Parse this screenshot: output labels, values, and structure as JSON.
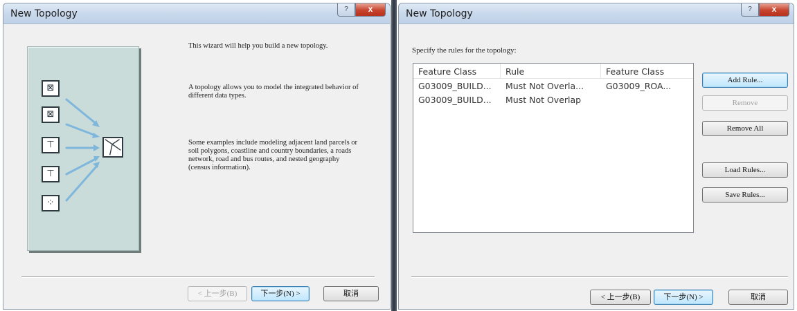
{
  "left_window": {
    "title": "New Topology",
    "close_label": "x",
    "help_label": "?",
    "illustration": {
      "feature_icons": [
        "polygon-layer-icon",
        "polygon-layer-icon",
        "line-layer-icon",
        "line-layer-icon",
        "point-layer-icon"
      ],
      "result_icon": "topology-icon"
    },
    "paragraphs": [
      "This wizard will help you build a new topology.",
      "A topology allows you to model the integrated behavior of different data types.",
      "Some examples include modeling adjacent land parcels or soil polygons, coastline and country boundaries, a roads network, road and bus routes, and nested geography (census information)."
    ],
    "buttons": {
      "back": "< 上一步(B)",
      "next": "下一步(N) >",
      "cancel": "取消"
    }
  },
  "right_window": {
    "title": "New Topology",
    "close_label": "x",
    "help_label": "?",
    "prompt": "Specify the rules for the topology:",
    "columns": [
      "Feature Class",
      "Rule",
      "Feature Class"
    ],
    "rows": [
      [
        "G03009_BUILD...",
        "Must Not Overla...",
        "G03009_ROA..."
      ],
      [
        "G03009_BUILD...",
        "Must Not Overlap",
        ""
      ]
    ],
    "side_buttons": {
      "add_rule": "Add Rule...",
      "remove": "Remove",
      "remove_all": "Remove All",
      "load_rules": "Load Rules...",
      "save_rules": "Save Rules..."
    },
    "buttons": {
      "back": "< 上一步(B)",
      "next": "下一步(N) >",
      "cancel": "取消"
    }
  },
  "colors": {
    "dialog_bg": "#f0f0f0",
    "illustration_bg": "#c9dcd9",
    "arrow_color": "#7fb6dc",
    "close_button": "#c7432c"
  }
}
